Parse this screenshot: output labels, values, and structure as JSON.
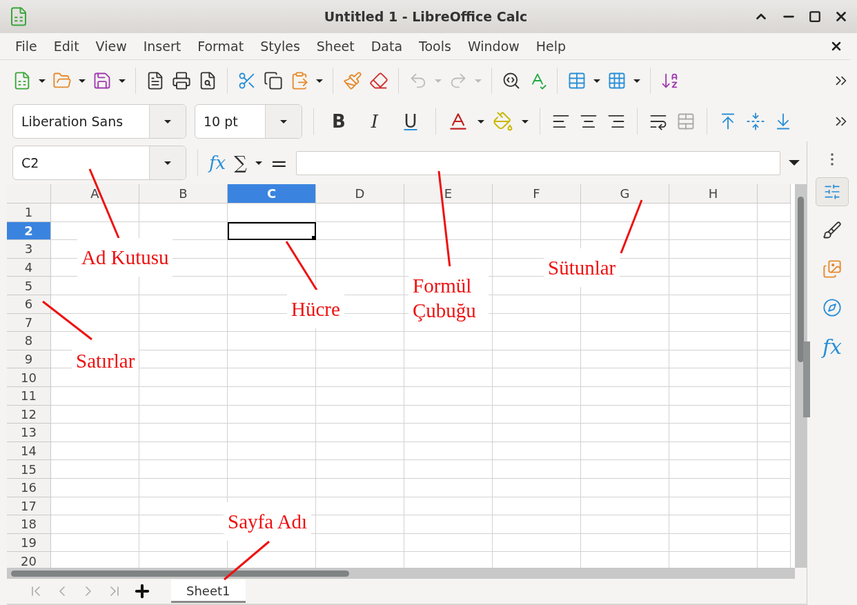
{
  "window": {
    "title": "Untitled 1 - LibreOffice Calc"
  },
  "menu": [
    "File",
    "Edit",
    "View",
    "Insert",
    "Format",
    "Styles",
    "Sheet",
    "Data",
    "Tools",
    "Window",
    "Help"
  ],
  "toolbar": {
    "undo": {
      "disabled": true
    },
    "redo": {
      "disabled": true
    }
  },
  "formatting": {
    "font_name": "Liberation Sans",
    "font_size": "10 pt",
    "bold": "B",
    "italic": "I",
    "underline": "U"
  },
  "name_box": {
    "value": "C2"
  },
  "formula_bar": {
    "function_wizard": "fx",
    "sum": "∑",
    "equals": "="
  },
  "columns": [
    {
      "label": "A",
      "selected": false
    },
    {
      "label": "B",
      "selected": false
    },
    {
      "label": "C",
      "selected": true
    },
    {
      "label": "D",
      "selected": false
    },
    {
      "label": "E",
      "selected": false
    },
    {
      "label": "F",
      "selected": false
    },
    {
      "label": "G",
      "selected": false
    },
    {
      "label": "H",
      "selected": false
    }
  ],
  "rows": [
    {
      "label": "1",
      "selected": false
    },
    {
      "label": "2",
      "selected": true
    },
    {
      "label": "3",
      "selected": false
    },
    {
      "label": "4",
      "selected": false
    },
    {
      "label": "5",
      "selected": false
    },
    {
      "label": "6",
      "selected": false
    },
    {
      "label": "7",
      "selected": false
    },
    {
      "label": "8",
      "selected": false
    },
    {
      "label": "9",
      "selected": false
    },
    {
      "label": "10",
      "selected": false
    },
    {
      "label": "11",
      "selected": false
    },
    {
      "label": "12",
      "selected": false
    },
    {
      "label": "13",
      "selected": false
    },
    {
      "label": "14",
      "selected": false
    },
    {
      "label": "15",
      "selected": false
    },
    {
      "label": "16",
      "selected": false
    },
    {
      "label": "17",
      "selected": false
    },
    {
      "label": "18",
      "selected": false
    },
    {
      "label": "19",
      "selected": false
    },
    {
      "label": "20",
      "selected": false
    }
  ],
  "sheet_tabs": [
    {
      "label": "Sheet1",
      "selected": true
    }
  ],
  "sidebar_tabs": [
    {
      "kind": "properties",
      "selected": true
    },
    {
      "kind": "styles",
      "selected": false
    },
    {
      "kind": "gallery",
      "selected": false
    },
    {
      "kind": "navigator",
      "selected": false
    },
    {
      "kind": "functions",
      "label": "fx",
      "selected": false
    }
  ],
  "annotations": [
    {
      "text": "Ad  Kutusu"
    },
    {
      "text": "Hücre"
    },
    {
      "text": "Formül Çubuğu"
    },
    {
      "text": "Sütunlar"
    },
    {
      "text": "Satırlar"
    },
    {
      "text": "Sayfa  Adı"
    }
  ]
}
